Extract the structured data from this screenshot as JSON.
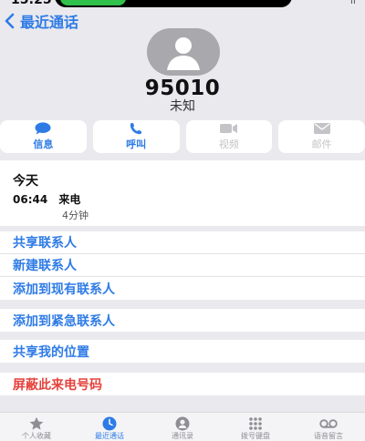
{
  "status_bar": {
    "time": "15:25",
    "indicator": "ll"
  },
  "nav": {
    "back_label": "最近通话"
  },
  "contact": {
    "number": "95010",
    "label": "未知"
  },
  "actions": [
    {
      "label": "信息",
      "icon": "message-icon",
      "enabled": true
    },
    {
      "label": "呼叫",
      "icon": "phone-icon",
      "enabled": true
    },
    {
      "label": "视频",
      "icon": "video-icon",
      "enabled": false
    },
    {
      "label": "邮件",
      "icon": "mail-icon",
      "enabled": false
    }
  ],
  "recent": {
    "day": "今天",
    "time": "06:44",
    "type": "来电",
    "duration": "4分钟"
  },
  "groups": {
    "contacts": [
      "共享联系人",
      "新建联系人",
      "添加到现有联系人"
    ],
    "emergency": [
      "添加到紧急联系人"
    ],
    "location": [
      "共享我的位置"
    ],
    "block": [
      "屏蔽此来电号码"
    ]
  },
  "tabbar": [
    {
      "label": "个人收藏",
      "icon": "star-icon",
      "active": false
    },
    {
      "label": "最近通话",
      "icon": "clock-icon",
      "active": true
    },
    {
      "label": "通讯录",
      "icon": "contacts-icon",
      "active": false
    },
    {
      "label": "拨号键盘",
      "icon": "keypad-icon",
      "active": false
    },
    {
      "label": "语音留言",
      "icon": "voicemail-icon",
      "active": false
    }
  ],
  "colors": {
    "accent": "#2e7be6",
    "danger": "#e5423c",
    "background": "#e9e9ee"
  }
}
